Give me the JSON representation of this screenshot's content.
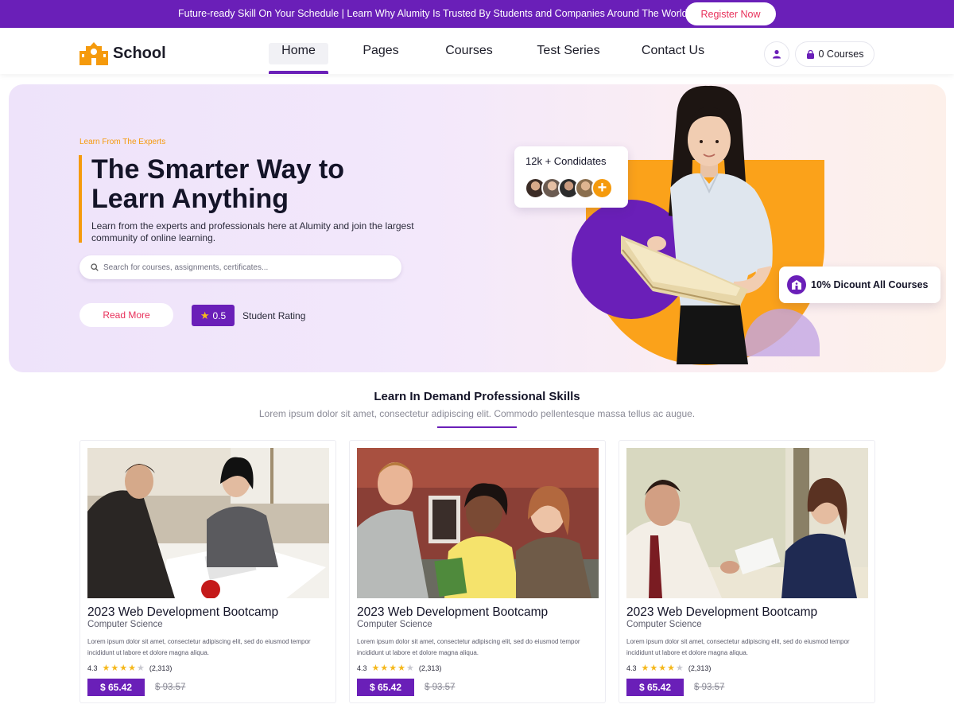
{
  "announcement": {
    "text": "Future-ready Skill On Your Schedule | Learn Why Alumity Is Trusted By Students and Companies Around The World.",
    "cta": "Register Now"
  },
  "header": {
    "logo_text": "School",
    "nav": [
      {
        "label": "Home",
        "active": true
      },
      {
        "label": "Pages",
        "active": false
      },
      {
        "label": "Courses",
        "active": false
      },
      {
        "label": "Test Series",
        "active": false
      },
      {
        "label": "Contact Us",
        "active": false
      }
    ],
    "user_icon": "user-icon",
    "cart_label": "0 Courses",
    "cart_icon": "bag-icon"
  },
  "hero": {
    "eyebrow": "Learn From The Experts",
    "title": "The Smarter Way to Learn Anything",
    "description": "Learn from the experts and professionals here at Alumity and join the largest community of online learning.",
    "search_placeholder": "Search for courses, assignments, certificates...",
    "read_more": "Read More",
    "rating_value": "0.5",
    "rating_label": "Student Rating",
    "candidates_text": "12k + Condidates",
    "discount_text": "10% Dicount All Courses"
  },
  "section": {
    "title": "Learn In Demand Professional Skills",
    "subtitle": "Lorem ipsum dolor sit amet, consectetur adipiscing elit. Commodo pellentesque massa tellus ac augue."
  },
  "courses": [
    {
      "title": "2023 Web Development Bootcamp",
      "category": "Computer Science",
      "description": "Lorem ipsum dolor sit amet, consectetur adipiscing elit, sed do eiusmod tempor incididunt ut labore et dolore magna aliqua.",
      "rating": "4.3",
      "stars": 4,
      "reviews": "(2,313)",
      "price": "$ 65.42",
      "old_price": "$ 93.57"
    },
    {
      "title": "2023 Web Development Bootcamp",
      "category": "Computer Science",
      "description": "Lorem ipsum dolor sit amet, consectetur adipiscing elit, sed do eiusmod tempor incididunt ut labore et dolore magna aliqua.",
      "rating": "4.3",
      "stars": 4,
      "reviews": "(2,313)",
      "price": "$ 65.42",
      "old_price": "$ 93.57"
    },
    {
      "title": "2023 Web Development Bootcamp",
      "category": "Computer Science",
      "description": "Lorem ipsum dolor sit amet, consectetur adipiscing elit, sed do eiusmod tempor incididunt ut labore et dolore magna aliqua.",
      "rating": "4.3",
      "stars": 4,
      "reviews": "(2,313)",
      "price": "$ 65.42",
      "old_price": "$ 93.57"
    }
  ],
  "colors": {
    "primary": "#6a1fb8",
    "accent_orange": "#f59a0c",
    "accent_pink": "#e8305a",
    "star": "#f5b81c"
  }
}
